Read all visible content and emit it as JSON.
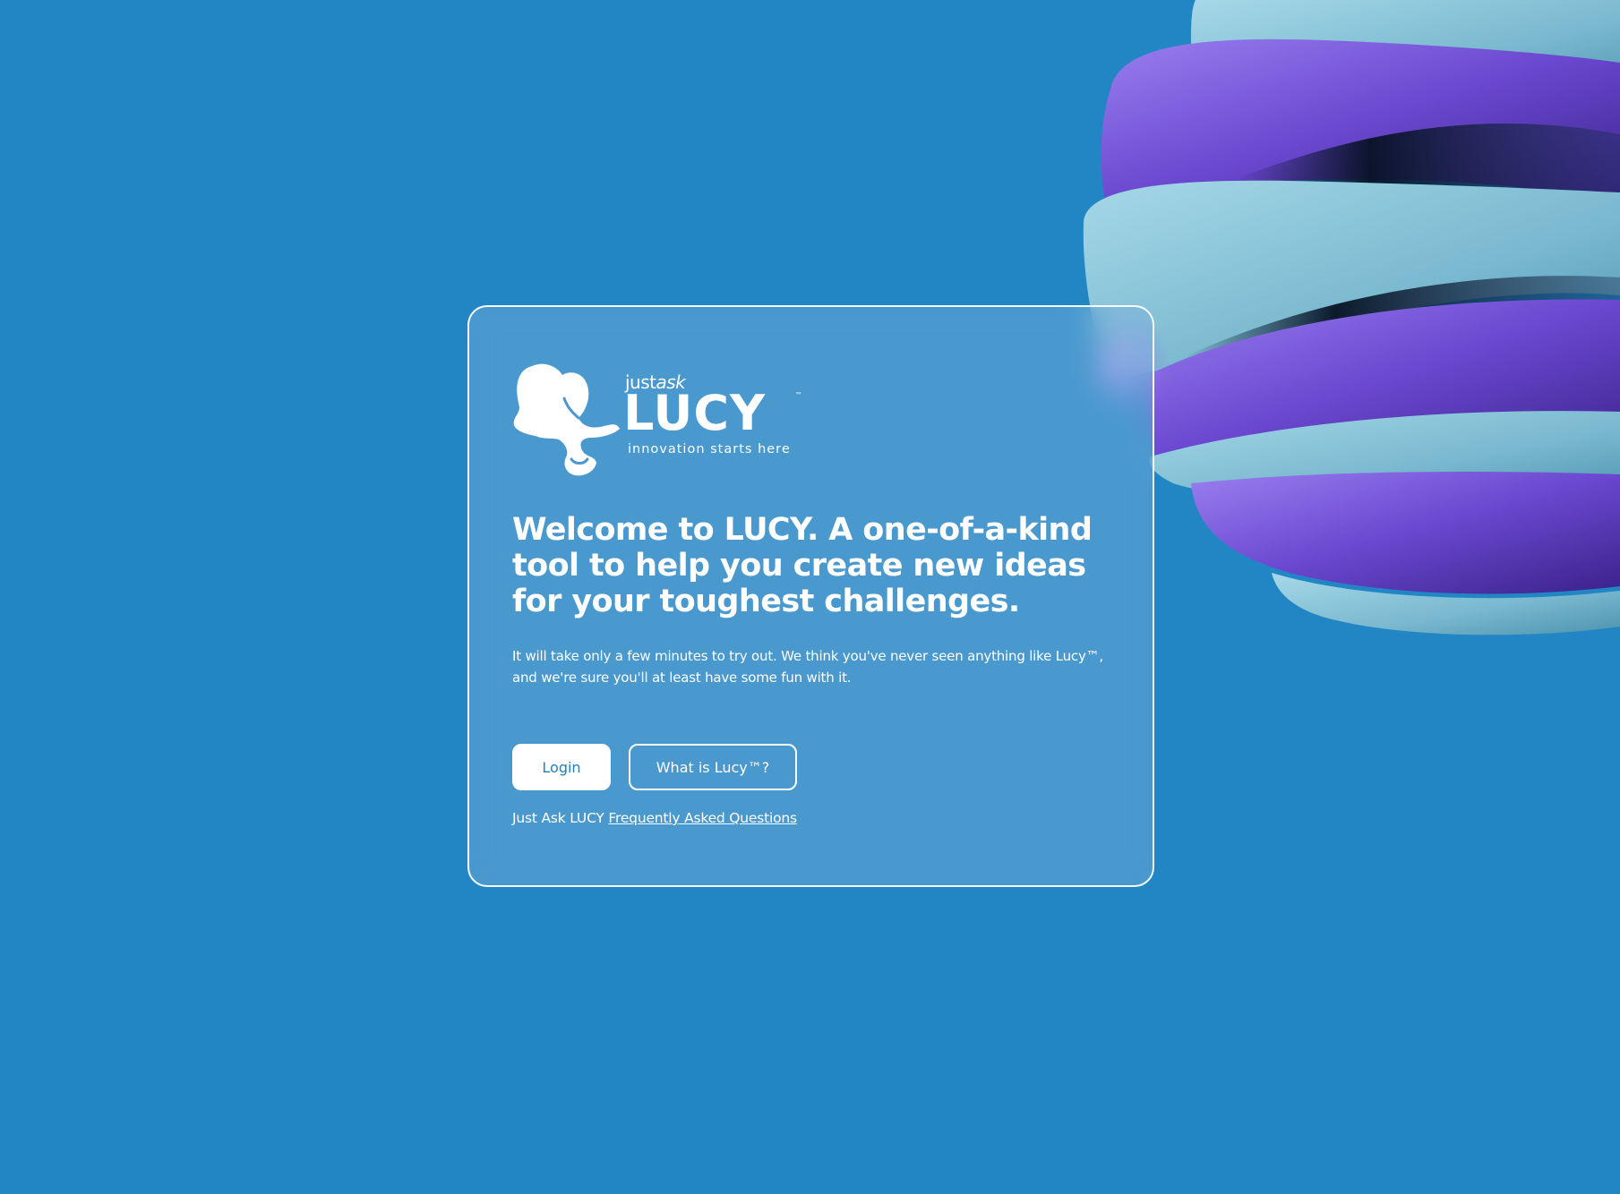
{
  "logo": {
    "just": "just",
    "ask": "ask",
    "name": "LUCY",
    "tm": "™",
    "tagline": "innovation starts here"
  },
  "hero": {
    "headline": "Welcome to LUCY. A one-of-a-kind tool to help you create new ideas for your toughest challenges.",
    "intro": "It will take only a few minutes to try out. We think you've never seen anything like Lucy™, and we're sure you'll at least have some fun with it."
  },
  "actions": {
    "login_label": "Login",
    "what_label": "What is Lucy™?"
  },
  "faq": {
    "prefix": "Just Ask LUCY",
    "link_label": "Frequently Asked Questions"
  },
  "colors": {
    "background": "#2386c4",
    "card_border": "#ffffff",
    "button_text": "#1f7fc0",
    "art_purple": "#7b58dc",
    "art_teal": "#8cc8dc"
  }
}
